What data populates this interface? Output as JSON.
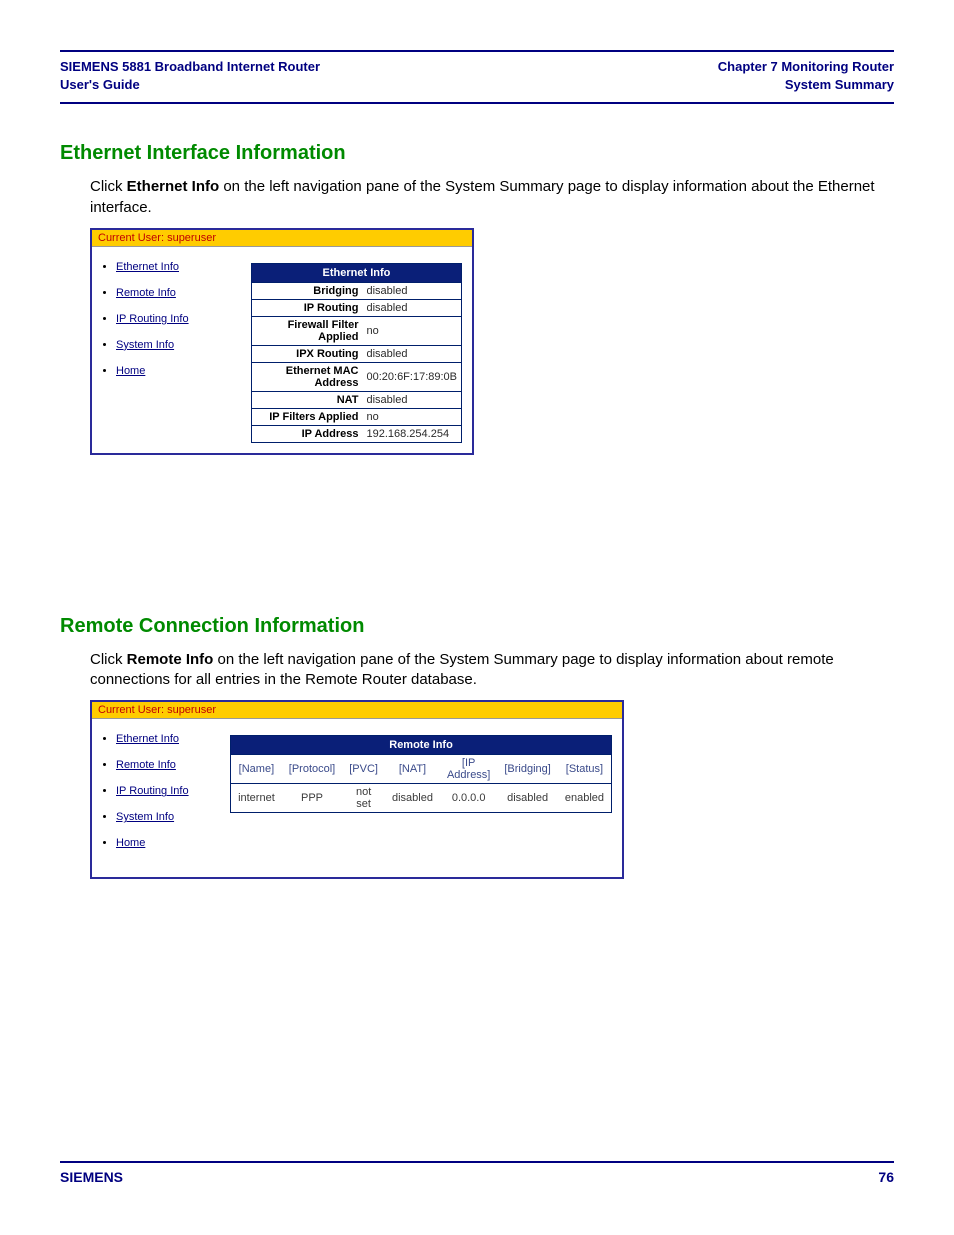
{
  "header": {
    "left_line1": "SIEMENS 5881 Broadband Internet Router",
    "left_line2": "User's Guide",
    "right_line1": "Chapter 7  Monitoring Router",
    "right_line2": "System Summary"
  },
  "section1": {
    "heading": "Ethernet Interface Information",
    "para_pre": "Click ",
    "para_bold": "Ethernet Info",
    "para_post": " on the left navigation pane of the System Summary page to display information about the Ethernet interface."
  },
  "section2": {
    "heading": "Remote Connection Information",
    "para_pre": "Click ",
    "para_bold": "Remote Info",
    "para_post": " on the left navigation pane of the System Summary page to display information about remote connections for all entries in the Remote Router database."
  },
  "shot": {
    "user_bar": "Current User: superuser",
    "nav": [
      "Ethernet Info",
      "Remote Info",
      "IP Routing Info",
      "System Info",
      "Home"
    ]
  },
  "ethernet_info": {
    "caption": "Ethernet Info",
    "rows": [
      {
        "label": "Bridging",
        "value": "disabled"
      },
      {
        "label": "IP Routing",
        "value": "disabled"
      },
      {
        "label": "Firewall Filter Applied",
        "value": "no"
      },
      {
        "label": "IPX Routing",
        "value": "disabled"
      },
      {
        "label": "Ethernet MAC Address",
        "value": "00:20:6F:17:89:0B"
      },
      {
        "label": "NAT",
        "value": "disabled"
      },
      {
        "label": "IP Filters Applied",
        "value": "no"
      },
      {
        "label": "IP Address",
        "value": "192.168.254.254"
      }
    ]
  },
  "remote_info": {
    "caption": "Remote Info",
    "headers": [
      "[Name]",
      "[Protocol]",
      "[PVC]",
      "[NAT]",
      "[IP Address]",
      "[Bridging]",
      "[Status]"
    ],
    "rows": [
      [
        "internet",
        "PPP",
        "not set",
        "disabled",
        "0.0.0.0",
        "disabled",
        "enabled"
      ]
    ]
  },
  "footer": {
    "brand": "SIEMENS",
    "page": "76"
  }
}
